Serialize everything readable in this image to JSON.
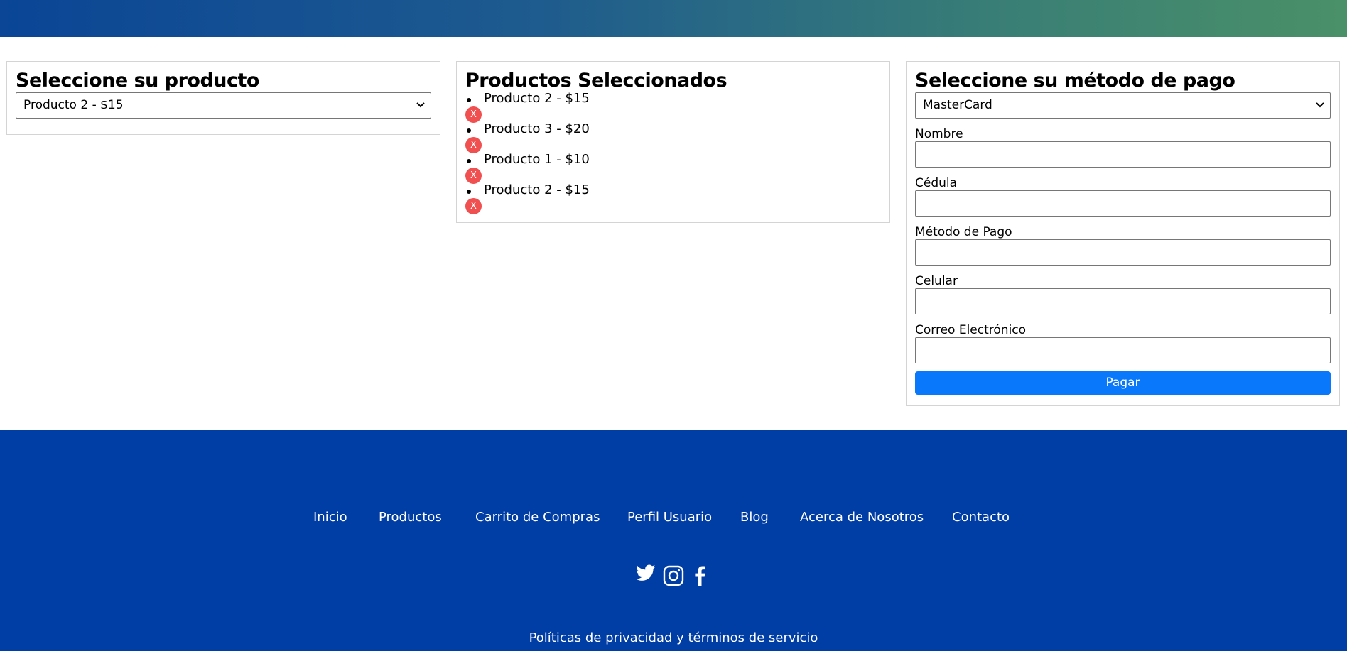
{
  "product_panel": {
    "title": "Seleccione su producto",
    "selected": "Producto 2 - $15"
  },
  "selected_panel": {
    "title": "Productos Seleccionados",
    "items": [
      {
        "label": "Producto 2 - $15",
        "remove": "X"
      },
      {
        "label": "Producto 3 - $20",
        "remove": "X"
      },
      {
        "label": "Producto 1 - $10",
        "remove": "X"
      },
      {
        "label": "Producto 2 - $15",
        "remove": "X"
      }
    ]
  },
  "payment_panel": {
    "title": "Seleccione su método de pago",
    "selected_method": "MasterCard",
    "fields": {
      "name": "Nombre",
      "id": "Cédula",
      "method": "Método de Pago",
      "phone": "Celular",
      "email": "Correo Electrónico"
    },
    "pay_button": "Pagar"
  },
  "footer": {
    "nav": [
      "Inicio",
      "Productos",
      "Carrito de Compras",
      "Perfil Usuario",
      "Blog",
      "Acerca de Nosotros",
      "Contacto"
    ],
    "social_icons": [
      "twitter-icon",
      "instagram-icon",
      "facebook-icon"
    ],
    "policy": "Políticas de privacidad y términos de servicio"
  },
  "colors": {
    "footer_bg": "#003da5",
    "pay_button": "#0a78fa",
    "remove_button": "#f05050"
  }
}
